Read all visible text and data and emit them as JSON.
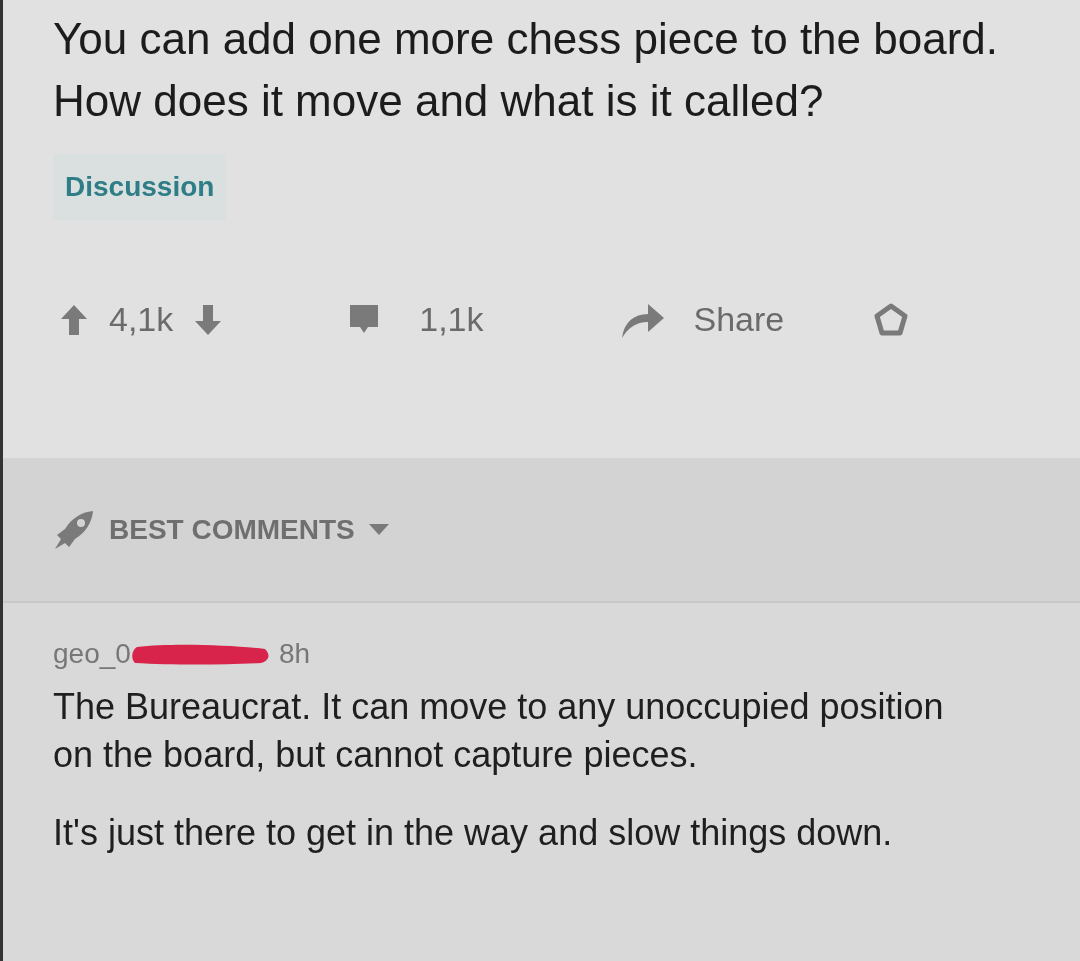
{
  "post": {
    "title": "You can add one more chess piece to the board. How does it move and what is it called?",
    "flair": "Discussion",
    "score": "4,1k",
    "comments": "1,1k",
    "share": "Share"
  },
  "sort": {
    "label": "BEST COMMENTS"
  },
  "comments": [
    {
      "author": "geo_0",
      "author_redacted": true,
      "time": "8h",
      "paragraphs": [
        "The Bureaucrat. It can move to any unoccupied position on the board, but cannot capture pieces.",
        "It's just there to get in the way and slow things down."
      ]
    }
  ]
}
